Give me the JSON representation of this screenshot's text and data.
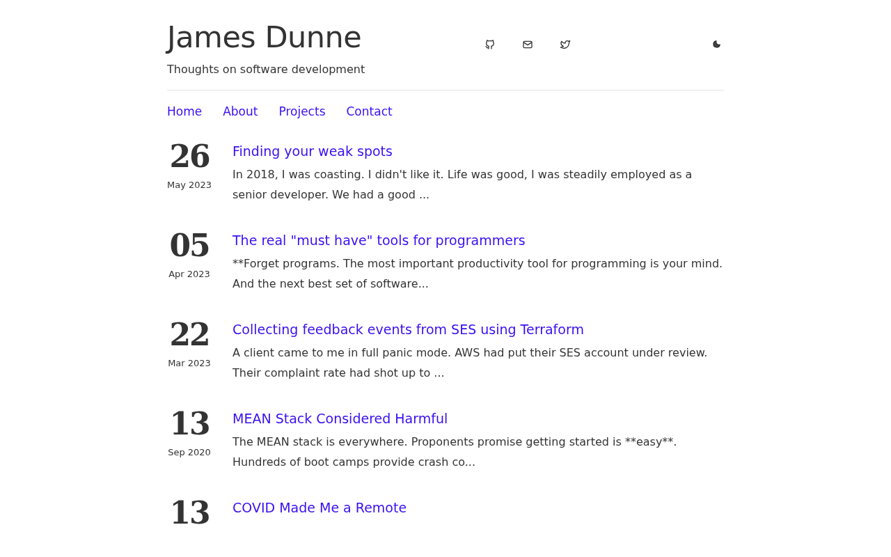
{
  "site": {
    "title": "James Dunne",
    "tagline": "Thoughts on software development"
  },
  "nav": [
    {
      "label": "Home"
    },
    {
      "label": "About"
    },
    {
      "label": "Projects"
    },
    {
      "label": "Contact"
    }
  ],
  "posts": [
    {
      "day": "26",
      "month": "May 2023",
      "title": "Finding your weak spots",
      "excerpt": "In 2018, I was coasting. I didn't like it. Life was good, I was steadily employed as a senior developer. We had a good ..."
    },
    {
      "day": "05",
      "month": "Apr 2023",
      "title": "The real \"must have\" tools for programmers",
      "excerpt": "**Forget programs. The most important productivity tool for programming is your mind. And the next best set of software..."
    },
    {
      "day": "22",
      "month": "Mar 2023",
      "title": "Collecting feedback events from SES using Terraform",
      "excerpt": "A client came to me in full panic mode. AWS had put their SES account under review. Their complaint rate had shot up to ..."
    },
    {
      "day": "13",
      "month": "Sep 2020",
      "title": "MEAN Stack Considered Harmful",
      "excerpt": "The MEAN stack is everywhere. Proponents promise getting started is **easy**. Hundreds of boot camps provide crash co..."
    },
    {
      "day": "13",
      "title": "COVID Made Me a Remote"
    }
  ]
}
